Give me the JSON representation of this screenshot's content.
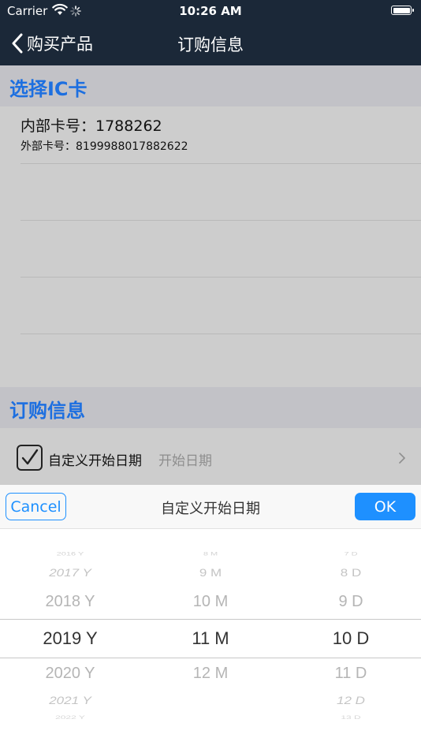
{
  "status_bar": {
    "carrier": "Carrier",
    "time": "10:26 AM"
  },
  "nav": {
    "back_label": "购买产品",
    "title": "订购信息"
  },
  "ic_section": {
    "header": "选择IC卡",
    "cards": [
      {
        "internal": "内部卡号：1788262",
        "external": "外部卡号：8199988017882622"
      }
    ]
  },
  "order_section": {
    "header": "订购信息",
    "custom_date_label": "自定义开始日期",
    "custom_date_placeholder": "开始日期",
    "custom_date_checked": true
  },
  "picker": {
    "cancel_label": "Cancel",
    "title": "自定义开始日期",
    "ok_label": "OK",
    "years": [
      "2016 Y",
      "2017 Y",
      "2018 Y",
      "2019 Y",
      "2020 Y",
      "2021 Y",
      "2022 Y"
    ],
    "months": [
      "8 M",
      "9 M",
      "10 M",
      "11 M",
      "12 M"
    ],
    "days": [
      "7 D",
      "8 D",
      "9 D",
      "10 D",
      "11 D",
      "12 D",
      "13 D"
    ],
    "selected": {
      "year": "2019 Y",
      "month": "11 M",
      "day": "10 D"
    }
  }
}
